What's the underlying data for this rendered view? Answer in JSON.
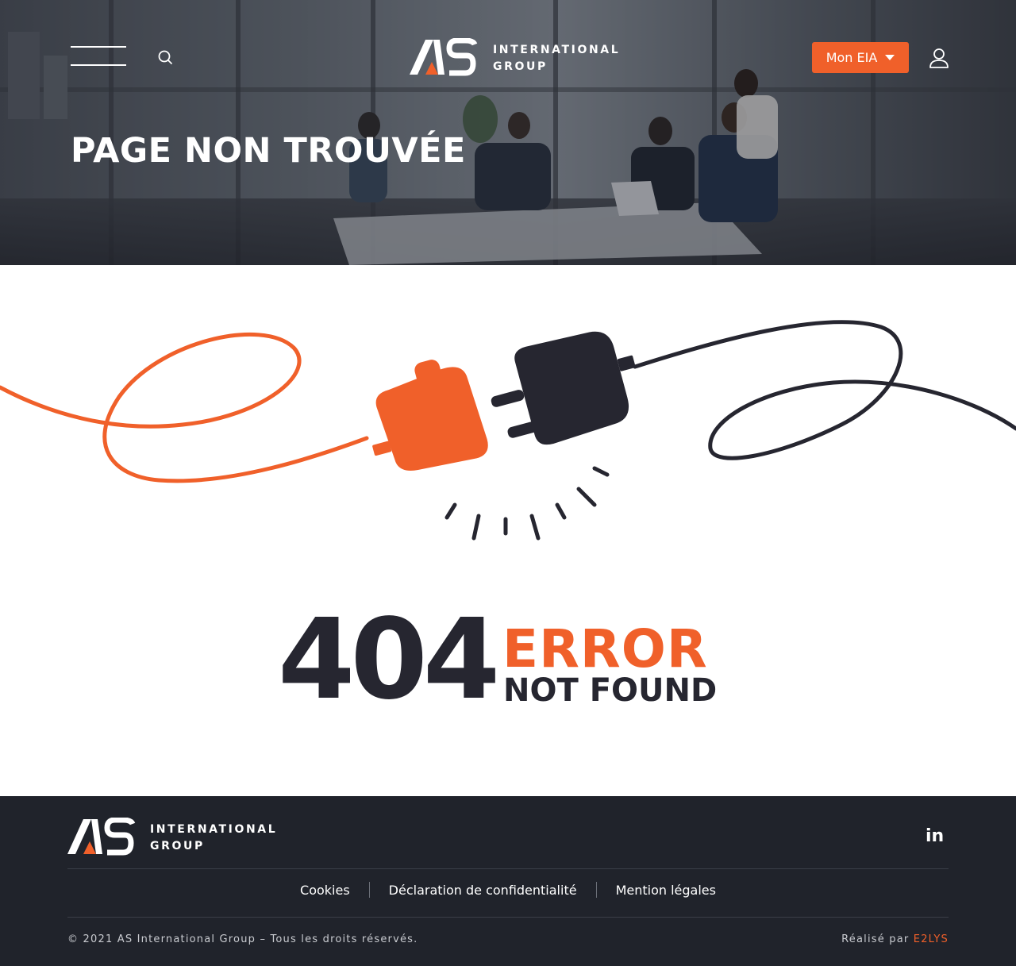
{
  "header": {
    "logo": {
      "line1": "INTERNATIONAL",
      "line2": "GROUP",
      "mark": "AS"
    },
    "account_menu_label": "Mon EIA",
    "page_title": "PAGE NON TROUVÉE"
  },
  "error": {
    "code": "404",
    "word": "ERROR",
    "message": "NOT FOUND"
  },
  "footer": {
    "logo": {
      "line1": "INTERNATIONAL",
      "line2": "GROUP",
      "mark": "AS"
    },
    "social": {
      "linkedin_label": "in"
    },
    "links": [
      {
        "label": "Cookies"
      },
      {
        "label": "Déclaration de confidentialité"
      },
      {
        "label": "Mention légales"
      }
    ],
    "copyright": "©  2021 AS International Group – Tous les droits réservés.",
    "credit_prefix": "Réalisé par ",
    "credit_name": "E2LYS"
  },
  "colors": {
    "accent": "#f0602a",
    "dark": "#262630",
    "footer_bg": "#20232b"
  },
  "icons": {
    "menu": "hamburger-menu-icon",
    "search": "search-icon",
    "user": "user-icon",
    "caret": "caret-down-icon",
    "linkedin": "linkedin-icon",
    "illustration": "unplugged-cable-illustration"
  }
}
